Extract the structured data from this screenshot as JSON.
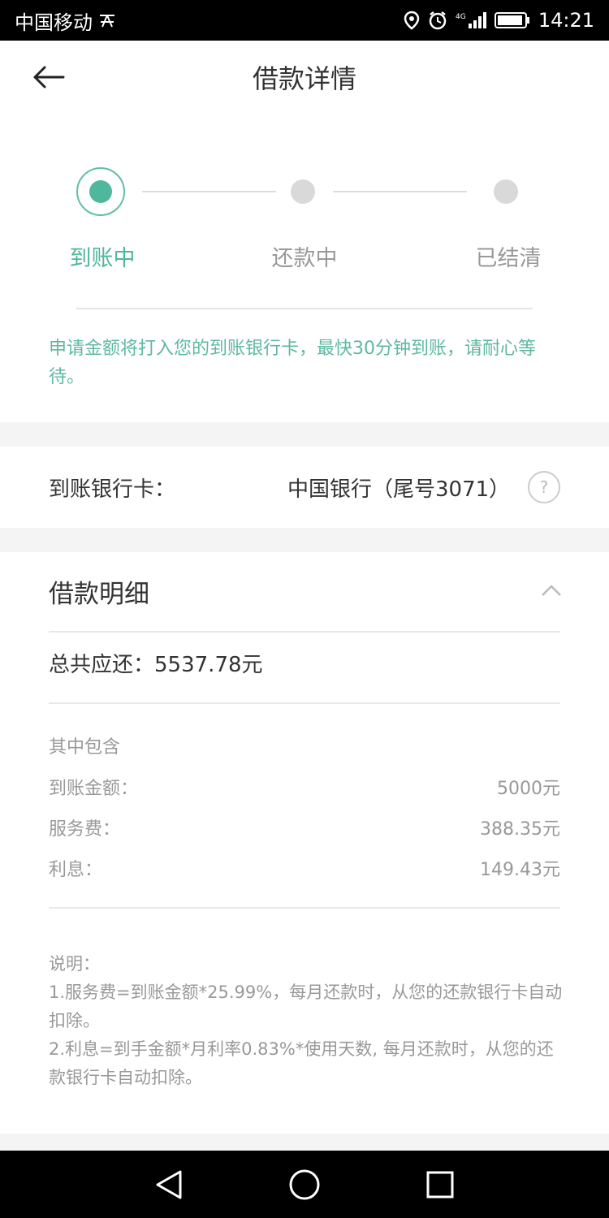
{
  "status_bar": {
    "carrier": "中国移动",
    "time": "14:21",
    "icons": [
      "usb-debug-icon",
      "location-icon",
      "alarm-icon",
      "signal-4g-icon",
      "battery-icon"
    ]
  },
  "header": {
    "title": "借款详情"
  },
  "progress": {
    "steps": [
      {
        "label": "到账中",
        "state": "active"
      },
      {
        "label": "还款中",
        "state": "inactive"
      },
      {
        "label": "已结清",
        "state": "inactive"
      }
    ],
    "notice": "申请金额将打入您的到账银行卡，最快30分钟到账，请耐心等待。"
  },
  "bank_card": {
    "label": "到账银行卡：",
    "value": "中国银行（尾号3071）",
    "help_symbol": "?"
  },
  "loan_detail": {
    "title": "借款明细",
    "total_label": "总共应还：",
    "total_value": "5537.78元",
    "includes_label": "其中包含",
    "rows": [
      {
        "label": "到账金额：",
        "value": "5000元"
      },
      {
        "label": "服务费：",
        "value": "388.35元"
      },
      {
        "label": "利息：",
        "value": "149.43元"
      }
    ],
    "notes_title": "说明：",
    "notes": [
      "1.服务费=到账金额*25.99%，每月还款时，从您的还款银行卡自动扣除。",
      "2.利息=到手金额*月利率0.83%*使用天数, 每月还款时，从您的还款银行卡自动扣除。"
    ]
  },
  "colors": {
    "accent": "#4fb79b",
    "notice_text": "#5fb8a1",
    "muted_text": "#999999"
  }
}
